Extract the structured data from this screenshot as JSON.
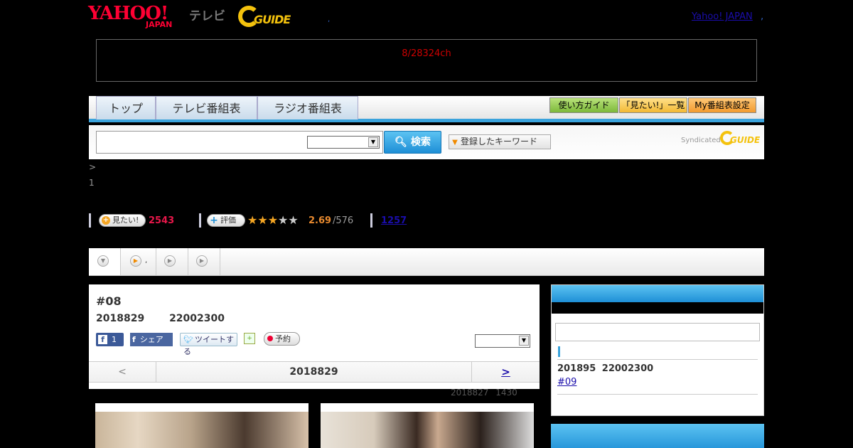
{
  "header": {
    "logo_yahoo": "YAHOO!",
    "logo_japan": "JAPAN",
    "logo_tv": "テレビ",
    "logo_gguide": "GUIDE",
    "dot": ",",
    "yahoo_japan_link": "Yahoo! JAPAN",
    "dot2": ","
  },
  "notice": {
    "text": "8/28324ch"
  },
  "nav": {
    "tabs": [
      {
        "label": "トップ"
      },
      {
        "label": "テレビ番組表"
      },
      {
        "label": "ラジオ番組表"
      }
    ],
    "guide": "使い方ガイド",
    "wantlist": "「見たい!」一覧",
    "mysettings": "My番組表設定",
    "colors": {
      "accent": "#3aa3dc",
      "green": "#8cc63f",
      "orange": "#f5a623"
    }
  },
  "search": {
    "button": "検索",
    "keyword_button": "登録したキーワード",
    "syndicated": "Syndicated",
    "syn_logo": "GUIDE"
  },
  "breadcrumb": {
    "sep": ">",
    "num": "1"
  },
  "stats": {
    "want_label": "見たい!",
    "want_count": "2543",
    "rate_label": "評価",
    "stars_on": "★★★",
    "stars_off": "★★",
    "rating": "2.69",
    "rating_total": "/576",
    "reviews": "1257"
  },
  "subtabs": {
    "dot": ","
  },
  "program": {
    "title": "#08",
    "time": "2018829 22002300",
    "fb_like_count": "1",
    "fb_share": "シェア",
    "tweet": "ツイートする",
    "record": "予約",
    "prev": "<",
    "date": "2018829",
    "next": ">",
    "updated": "2018827 1430"
  },
  "sidebar": {
    "time": "201895 22002300",
    "episode": "#09"
  }
}
